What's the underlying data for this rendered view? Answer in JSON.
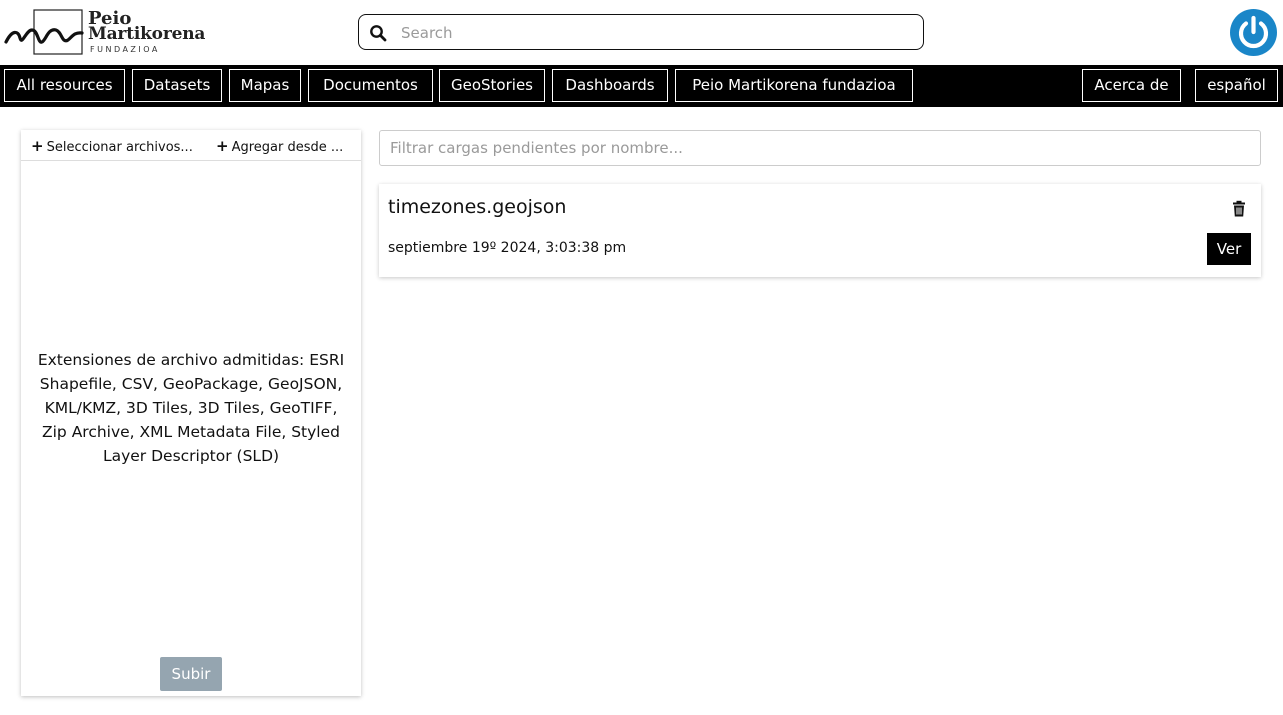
{
  "header": {
    "logo": {
      "line1": "Peio",
      "line2": "Martikorena",
      "line3": "FUNDAZIOA"
    },
    "search": {
      "placeholder": "Search",
      "value": "",
      "icon": "search-icon"
    },
    "user_icon": "power-icon",
    "user_icon_color": "#1a86c8"
  },
  "nav": {
    "items": [
      {
        "label": "All resources"
      },
      {
        "label": "Datasets"
      },
      {
        "label": "Mapas"
      },
      {
        "label": "Documentos"
      },
      {
        "label": "GeoStories"
      },
      {
        "label": "Dashboards"
      },
      {
        "label": "Peio Martikorena fundazioa"
      }
    ],
    "right": [
      {
        "label": "Acerca de"
      },
      {
        "label": "español"
      }
    ]
  },
  "upload_panel": {
    "select_files_label": "Seleccionar archivos...",
    "add_from_label": "Agregar desde ...",
    "supported_extensions": "Extensiones de archivo admitidas: ESRI Shapefile, CSV, GeoPackage, GeoJSON, KML/KMZ, 3D Tiles, 3D Tiles, GeoTIFF, Zip Archive, XML Metadata File, Styled Layer Descriptor (SLD)",
    "submit_label": "Subir",
    "submit_color": "#95a5b0"
  },
  "pending": {
    "filter_placeholder": "Filtrar cargas pendientes por nombre...",
    "uploads": [
      {
        "name": "timezones.geojson",
        "date": "septiembre 19º 2024, 3:03:38 pm",
        "view_label": "Ver",
        "delete_icon": "trash-icon"
      }
    ]
  }
}
